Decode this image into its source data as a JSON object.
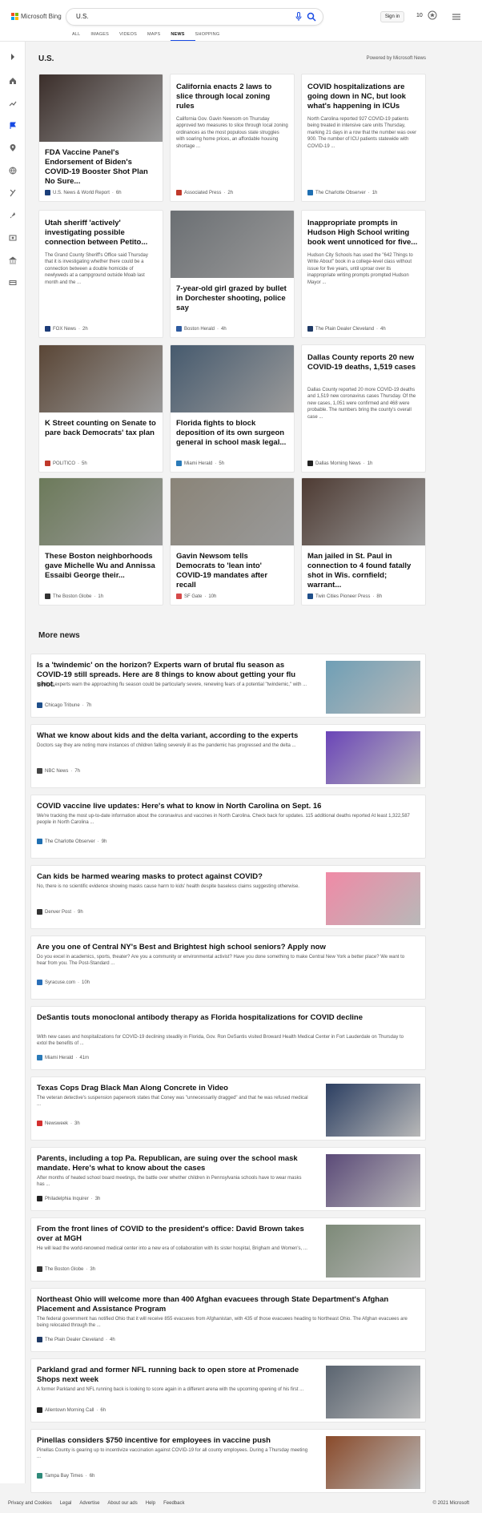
{
  "header": {
    "logo_text": "Microsoft Bing",
    "search_value": "U.S.",
    "signin_label": "Sign in",
    "points": "10"
  },
  "tabs": [
    {
      "label": "ALL",
      "active": false
    },
    {
      "label": "IMAGES",
      "active": false
    },
    {
      "label": "VIDEOS",
      "active": false
    },
    {
      "label": "MAPS",
      "active": false
    },
    {
      "label": "NEWS",
      "active": true
    },
    {
      "label": "SHOPPING",
      "active": false
    }
  ],
  "section": {
    "title": "U.S.",
    "powered_by": "Powered by Microsoft News"
  },
  "cards": [
    {
      "title": "FDA Vaccine Panel's Endorsement of Biden's COVID-19 Booster Shot Plan No Sure...",
      "snippet": "",
      "source": "U.S. News & World Report",
      "age": "6h",
      "has_image": true,
      "img_color": "#3b2e2a",
      "logo_color": "#1c3f7a"
    },
    {
      "title": "California enacts 2 laws to slice through local zoning rules",
      "snippet": "California Gov. Gavin Newsom on Thursday approved two measures to slice through local zoning ordinances as the most populous state struggles with soaring home prices, an affordable housing shortage ...",
      "source": "Associated Press",
      "age": "2h",
      "has_image": false,
      "logo_color": "#c0392b"
    },
    {
      "title": "COVID hospitalizations are going down in NC, but look what's happening in ICUs",
      "snippet": "North Carolina reported 927 COVID-19 patients being treated in intensive care units Thursday, marking 21 days in a row that the number was over 900. The number of ICU patients statewide with COVID-19 ...",
      "source": "The Charlotte Observer",
      "age": "1h",
      "has_image": false,
      "logo_color": "#1f6fb2"
    },
    {
      "title": "Utah sheriff 'actively' investigating possible connection between Petito...",
      "snippet": "The Grand County Sheriff's Office said Thursday that it is investigating whether there could be a connection between a double homicide of newlyweds at a campground outside Moab last month and the ...",
      "source": "FOX News",
      "age": "2h",
      "has_image": false,
      "logo_color": "#1d3c78"
    },
    {
      "title": "7-year-old girl grazed by bullet in Dorchester shooting, police say",
      "snippet": "",
      "source": "Boston Herald",
      "age": "4h",
      "has_image": true,
      "img_color": "#6b6f73",
      "logo_color": "#2d5aa0"
    },
    {
      "title": "Inappropriate prompts in Hudson High School writing book went unnoticed for five...",
      "snippet": "Hudson City Schools has used the \"642 Things to Write About\" book in a college-level class without issue for five years, until uproar over its inappropriate writing prompts prompted Hudson Mayor ...",
      "source": "The Plain Dealer Cleveland",
      "age": "4h",
      "has_image": false,
      "logo_color": "#1f3a66"
    },
    {
      "title": "K Street counting on Senate to pare back Democrats' tax plan",
      "snippet": "",
      "source": "POLITICO",
      "age": "5h",
      "has_image": true,
      "img_color": "#5a4636",
      "logo_color": "#c0392b"
    },
    {
      "title": "Florida fights to block deposition of its own surgeon general in school mask legal...",
      "snippet": "",
      "source": "Miami Herald",
      "age": "5h",
      "has_image": true,
      "img_color": "#465a6e",
      "logo_color": "#2a7ab8"
    },
    {
      "title": "Dallas County reports 20 new COVID-19 deaths, 1,519 cases",
      "snippet": "Dallas County reported 20 more COVID-19 deaths and 1,519 new coronavirus cases Thursday. Of the new cases, 1,051 were confirmed and 468 were probable. The numbers bring the county's overall case ...",
      "source": "Dallas Morning News",
      "age": "1h",
      "has_image": false,
      "logo_color": "#222222"
    },
    {
      "title": "These Boston neighborhoods gave Michelle Wu and Annissa Essaibi George their...",
      "snippet": "",
      "source": "The Boston Globe",
      "age": "1h",
      "has_image": true,
      "img_color": "#6c7a5a",
      "logo_color": "#333333"
    },
    {
      "title": "Gavin Newsom tells Democrats to 'lean into' COVID-19 mandates after recall",
      "snippet": "",
      "source": "SF Gate",
      "age": "10h",
      "has_image": true,
      "img_color": "#8a8478",
      "logo_color": "#d64a4a"
    },
    {
      "title": "Man jailed in St. Paul in connection to 4 found fatally shot in Wis. cornfield; warrant...",
      "snippet": "",
      "source": "Twin Cities Pioneer Press",
      "age": "8h",
      "has_image": true,
      "img_color": "#4e3b33",
      "logo_color": "#1f4f8a"
    }
  ],
  "more_news": {
    "title": "More news",
    "items": [
      {
        "title": "Is a 'twindemic' on the horizon? Experts warn of brutal flu season as COVID-19 still spreads. Here are 8 things to know about getting your flu shot.",
        "snippet": "Medical experts warn the approaching flu season could be particularly severe, renewing fears of a potential \"twindemic,\" with ...",
        "source": "Chicago Tribune",
        "age": "7h",
        "img_color": "#6f9fb6",
        "logo_color": "#1f4f8a"
      },
      {
        "title": "What we know about kids and the delta variant, according to the experts",
        "snippet": "Doctors say they are noting more instances of children falling severely ill as the pandemic has progressed and the delta ...",
        "source": "NBC News",
        "age": "7h",
        "img_color": "#6a44b8",
        "logo_color": "#444444"
      },
      {
        "title": "COVID vaccine live updates: Here's what to know in North Carolina on Sept. 16",
        "snippet": "We're tracking the most up-to-date information about the coronavirus and vaccines in North Carolina. Check back for updates. 115 additional deaths reported At least 1,322,587 people in North Carolina ...",
        "source": "The Charlotte Observer",
        "age": "9h",
        "img_color": "",
        "logo_color": "#1f6fb2"
      },
      {
        "title": "Can kids be harmed wearing masks to protect against COVID?",
        "snippet": "No, there is no scientific evidence showing masks cause harm to kids' health despite baseless claims suggesting otherwise.",
        "source": "Denver Post",
        "age": "9h",
        "img_color": "#f08aa6",
        "logo_color": "#333333"
      },
      {
        "title": "Are you one of Central NY's Best and Brightest high school seniors? Apply now",
        "snippet": "Do you excel in academics, sports, theater? Are you a community or environmental activist? Have you done something to make Central New York a better place? We want to hear from you. The Post-Standard ...",
        "source": "Syracuse.com",
        "age": "10h",
        "img_color": "",
        "logo_color": "#2a6fb8"
      },
      {
        "title": "DeSantis touts monoclonal antibody therapy as Florida hospitalizations for COVID decline",
        "snippet": "With new cases and hospitalizations for COVID-19 declining steadily in Florida, Gov. Ron DeSantis visited Broward Health Medical Center in Fort Lauderdale on Thursday to extol the benefits of ...",
        "source": "Miami Herald",
        "age": "41m",
        "img_color": "",
        "logo_color": "#2a7ab8"
      },
      {
        "title": "Texas Cops Drag Black Man Along Concrete in Video",
        "snippet": "The veteran detective's suspension paperwork states that Coney was \"unnecessarily dragged\" and that he was refused medical ...",
        "source": "Newsweek",
        "age": "3h",
        "img_color": "#2c3f62",
        "logo_color": "#d32f2f"
      },
      {
        "title": "Parents, including a top Pa. Republican, are suing over the school mask mandate. Here's what to know about the cases",
        "snippet": "After months of heated school board meetings, the battle over whether children in Pennsylvania schools have to wear masks has ...",
        "source": "Philadelphia Inquirer",
        "age": "3h",
        "img_color": "#5b4a78",
        "logo_color": "#222222"
      },
      {
        "title": "From the front lines of COVID to the president's office: David Brown takes over at MGH",
        "snippet": "He will lead the world-renowned medical center into a new era of collaboration with its sister hospital, Brigham and Women's, ...",
        "source": "The Boston Globe",
        "age": "3h",
        "img_color": "#7d8a78",
        "logo_color": "#333333"
      },
      {
        "title": "Northeast Ohio will welcome more than 400 Afghan evacuees through State Department's Afghan Placement and Assistance Program",
        "snippet": "The federal government has notified Ohio that it will receive 855 evacuees from Afghanistan, with 435 of those evacuees heading to Northeast Ohio. The Afghan evacuees are being relocated through the ...",
        "source": "The Plain Dealer Cleveland",
        "age": "4h",
        "img_color": "",
        "logo_color": "#1f3a66"
      },
      {
        "title": "Parkland grad and former NFL running back to open store at Promenade Shops next week",
        "snippet": "A former Parkland and NFL running back is looking to score again in a different arena with the upcoming opening of his first ...",
        "source": "Allentown Morning Call",
        "age": "6h",
        "img_color": "#5a6470",
        "logo_color": "#222222"
      },
      {
        "title": "Pinellas considers $750 incentive for employees in vaccine push",
        "snippet": "Pinellas County is gearing up to incentivize vaccination against COVID-19 for all county employees. During a Thursday meeting ...",
        "source": "Tampa Bay Times",
        "age": "6h",
        "img_color": "#8a4a2a",
        "logo_color": "#2f8a7a"
      }
    ]
  },
  "footer": {
    "links": [
      "Privacy and Cookies",
      "Legal",
      "Advertise",
      "About our ads",
      "Help",
      "Feedback"
    ],
    "copyright": "© 2021 Microsoft"
  }
}
